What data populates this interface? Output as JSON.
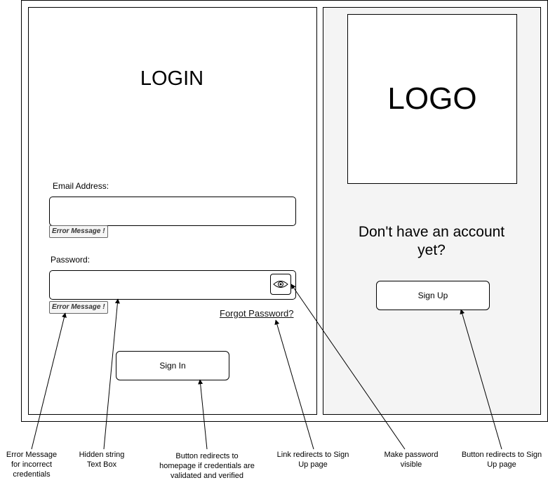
{
  "login": {
    "title": "LOGIN",
    "email_label": "Email Address:",
    "email_value": "",
    "email_error": "Error Message !",
    "password_label": "Password:",
    "password_value": "",
    "password_error": "Error Message !",
    "forgot_link": "Forgot Password?",
    "sign_in_label": "Sign In"
  },
  "signup_panel": {
    "logo_text": "LOGO",
    "prompt": "Don't have an account yet?",
    "sign_up_label": "Sign Up"
  },
  "annotations": {
    "error_message": "Error Message for incorrect credentials",
    "hidden_string": "Hidden string Text Box",
    "sign_in_note": "Button redirects to homepage if credentials are validated and verified",
    "link_note": "Link redirects to Sign Up page",
    "eye_note": "Make password visible",
    "sign_up_note": "Button redirects to Sign Up page"
  },
  "icons": {
    "eye": "eye-icon"
  }
}
